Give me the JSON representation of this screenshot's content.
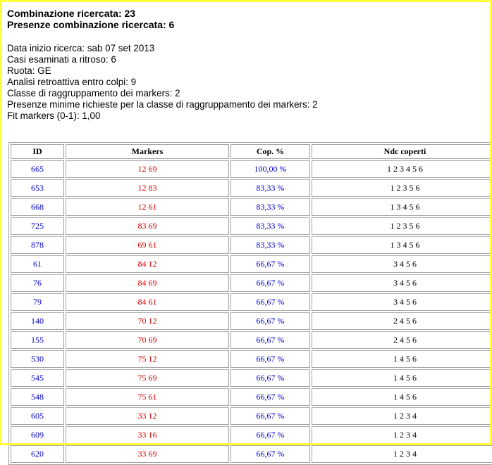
{
  "header": {
    "line1": "Combinazione ricercata: 23",
    "line2": "Presenze combinazione ricercata: 6"
  },
  "info": [
    "Data inizio ricerca: sab 07 set 2013",
    "Casi esaminati a ritroso: 6",
    "Ruota: GE",
    "Analisi retroattiva entro colpi: 9",
    "Classe di raggruppamento dei markers: 2",
    "Presenze minime richieste per la classe di raggruppamento dei markers: 2",
    "Fit markers (0-1): 1,00"
  ],
  "table": {
    "headers": [
      "ID",
      "Markers",
      "Cop. %",
      "Ndc coperti"
    ],
    "rows": [
      [
        "665",
        "12 69",
        "100,00 %",
        "1 2 3 4 5 6"
      ],
      [
        "653",
        "12 83",
        "83,33 %",
        "1 2 3 5 6"
      ],
      [
        "668",
        "12 61",
        "83,33 %",
        "1 3 4 5 6"
      ],
      [
        "725",
        "83 69",
        "83,33 %",
        "1 2 3 5 6"
      ],
      [
        "878",
        "69 61",
        "83,33 %",
        "1 3 4 5 6"
      ],
      [
        "61",
        "84 12",
        "66,67 %",
        "3 4 5 6"
      ],
      [
        "76",
        "84 69",
        "66,67 %",
        "3 4 5 6"
      ],
      [
        "79",
        "84 61",
        "66,67 %",
        "3 4 5 6"
      ],
      [
        "140",
        "70 12",
        "66,67 %",
        "2 4 5 6"
      ],
      [
        "155",
        "70 69",
        "66,67 %",
        "2 4 5 6"
      ],
      [
        "530",
        "75 12",
        "66,67 %",
        "1 4 5 6"
      ],
      [
        "545",
        "75 69",
        "66,67 %",
        "1 4 5 6"
      ],
      [
        "548",
        "75 61",
        "66,67 %",
        "1 4 5 6"
      ],
      [
        "605",
        "33 12",
        "66,67 %",
        "1 2 3 4"
      ],
      [
        "609",
        "33 16",
        "66,67 %",
        "1 2 3 4"
      ],
      [
        "620",
        "33 69",
        "66,67 %",
        "1 2 3 4"
      ]
    ]
  },
  "colors": {
    "frame": "#ffff3c",
    "id": "#0000cc",
    "markers": "#dd0000",
    "cop": "#0000cc"
  }
}
